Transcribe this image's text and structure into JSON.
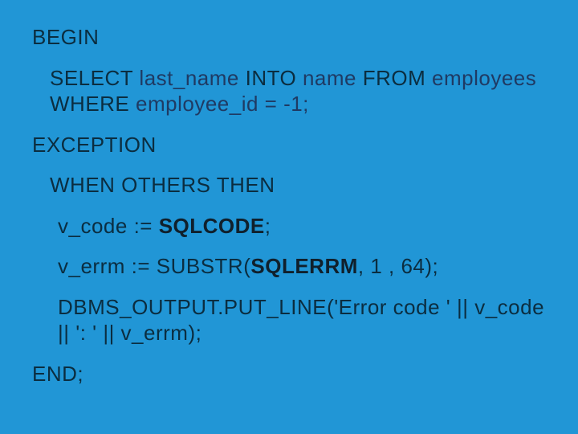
{
  "code": {
    "l1": "BEGIN",
    "l2a": "SELECT",
    "l2b": " last_name ",
    "l2c": "INTO",
    "l2d": " name ",
    "l2e": "FROM",
    "l2f": " employees ",
    "l2g": "WHERE",
    "l2h": " employee_id = -1;",
    "l3": "EXCEPTION",
    "l4": "WHEN OTHERS THEN",
    "l5a": "v_code := ",
    "l5b": "SQLCODE",
    "l5c": ";",
    "l6a": "v_errm := SUBSTR(",
    "l6b": "SQLERRM",
    "l6c": ", 1 , 64);",
    "l7": "DBMS_OUTPUT.PUT_LINE('Error code ' || v_code || ': ' || v_errm);",
    "l8": "END;"
  }
}
